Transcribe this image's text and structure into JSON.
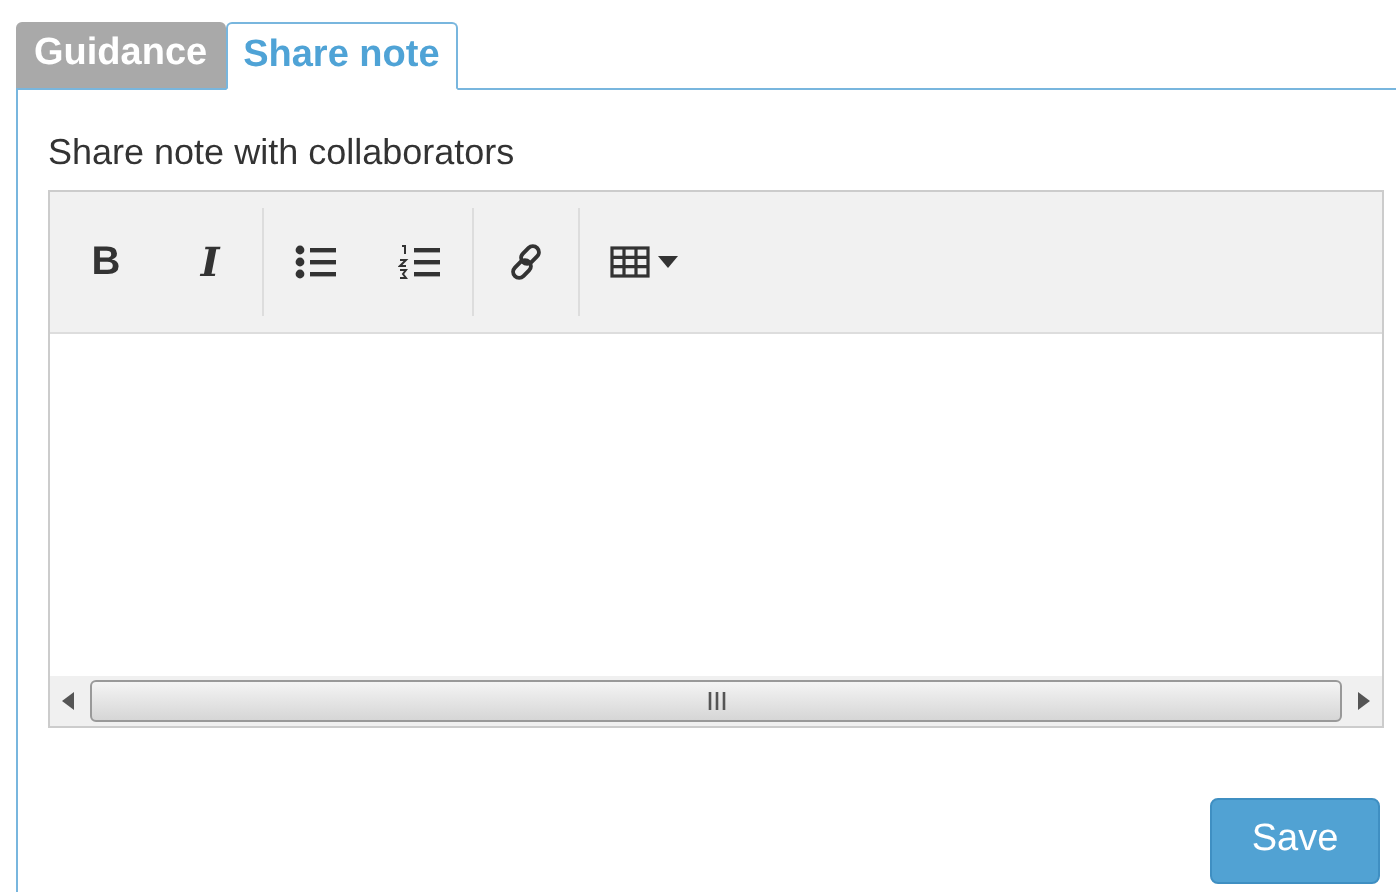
{
  "tabs": [
    {
      "label": "Guidance",
      "selected": false
    },
    {
      "label": "Share note",
      "selected": true
    }
  ],
  "editor": {
    "label": "Share note with collaborators",
    "toolbar": [
      [
        {
          "kind": "bold",
          "label": "B"
        },
        {
          "kind": "italic",
          "label": "I"
        }
      ],
      [
        {
          "kind": "bullets"
        },
        {
          "kind": "numbers"
        }
      ],
      [
        {
          "kind": "link"
        }
      ],
      [
        {
          "kind": "table"
        }
      ]
    ]
  },
  "save_button": "Save"
}
